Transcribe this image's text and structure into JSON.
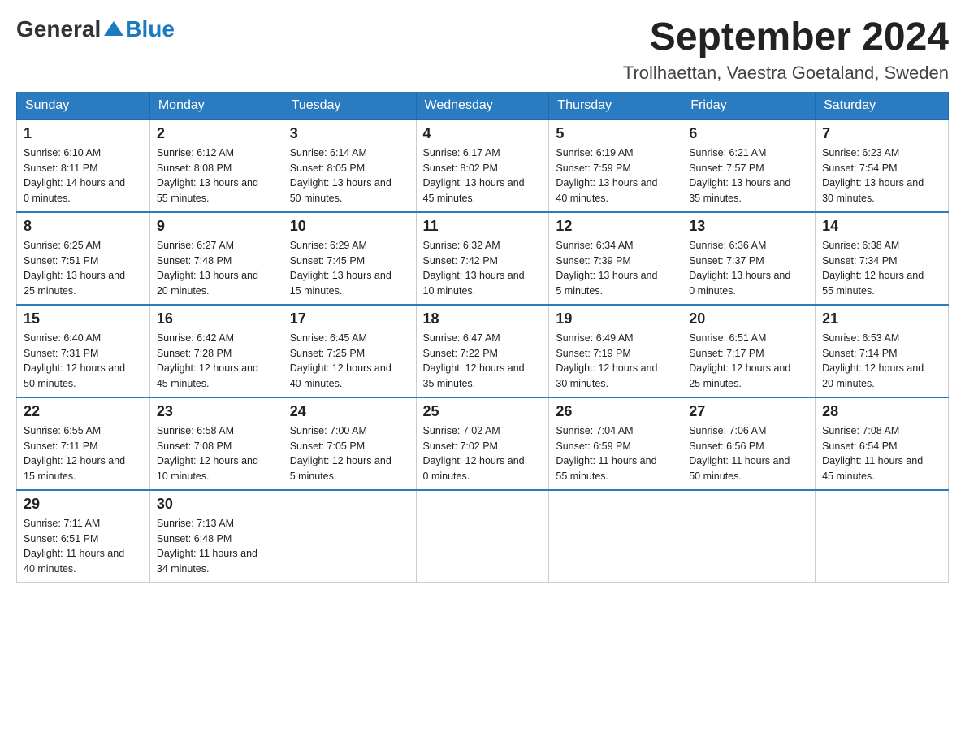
{
  "header": {
    "logo_general": "General",
    "logo_blue": "Blue",
    "month_title": "September 2024",
    "location": "Trollhaettan, Vaestra Goetaland, Sweden"
  },
  "weekdays": [
    "Sunday",
    "Monday",
    "Tuesday",
    "Wednesday",
    "Thursday",
    "Friday",
    "Saturday"
  ],
  "weeks": [
    [
      {
        "day": "1",
        "sunrise": "6:10 AM",
        "sunset": "8:11 PM",
        "daylight": "14 hours and 0 minutes."
      },
      {
        "day": "2",
        "sunrise": "6:12 AM",
        "sunset": "8:08 PM",
        "daylight": "13 hours and 55 minutes."
      },
      {
        "day": "3",
        "sunrise": "6:14 AM",
        "sunset": "8:05 PM",
        "daylight": "13 hours and 50 minutes."
      },
      {
        "day": "4",
        "sunrise": "6:17 AM",
        "sunset": "8:02 PM",
        "daylight": "13 hours and 45 minutes."
      },
      {
        "day": "5",
        "sunrise": "6:19 AM",
        "sunset": "7:59 PM",
        "daylight": "13 hours and 40 minutes."
      },
      {
        "day": "6",
        "sunrise": "6:21 AM",
        "sunset": "7:57 PM",
        "daylight": "13 hours and 35 minutes."
      },
      {
        "day": "7",
        "sunrise": "6:23 AM",
        "sunset": "7:54 PM",
        "daylight": "13 hours and 30 minutes."
      }
    ],
    [
      {
        "day": "8",
        "sunrise": "6:25 AM",
        "sunset": "7:51 PM",
        "daylight": "13 hours and 25 minutes."
      },
      {
        "day": "9",
        "sunrise": "6:27 AM",
        "sunset": "7:48 PM",
        "daylight": "13 hours and 20 minutes."
      },
      {
        "day": "10",
        "sunrise": "6:29 AM",
        "sunset": "7:45 PM",
        "daylight": "13 hours and 15 minutes."
      },
      {
        "day": "11",
        "sunrise": "6:32 AM",
        "sunset": "7:42 PM",
        "daylight": "13 hours and 10 minutes."
      },
      {
        "day": "12",
        "sunrise": "6:34 AM",
        "sunset": "7:39 PM",
        "daylight": "13 hours and 5 minutes."
      },
      {
        "day": "13",
        "sunrise": "6:36 AM",
        "sunset": "7:37 PM",
        "daylight": "13 hours and 0 minutes."
      },
      {
        "day": "14",
        "sunrise": "6:38 AM",
        "sunset": "7:34 PM",
        "daylight": "12 hours and 55 minutes."
      }
    ],
    [
      {
        "day": "15",
        "sunrise": "6:40 AM",
        "sunset": "7:31 PM",
        "daylight": "12 hours and 50 minutes."
      },
      {
        "day": "16",
        "sunrise": "6:42 AM",
        "sunset": "7:28 PM",
        "daylight": "12 hours and 45 minutes."
      },
      {
        "day": "17",
        "sunrise": "6:45 AM",
        "sunset": "7:25 PM",
        "daylight": "12 hours and 40 minutes."
      },
      {
        "day": "18",
        "sunrise": "6:47 AM",
        "sunset": "7:22 PM",
        "daylight": "12 hours and 35 minutes."
      },
      {
        "day": "19",
        "sunrise": "6:49 AM",
        "sunset": "7:19 PM",
        "daylight": "12 hours and 30 minutes."
      },
      {
        "day": "20",
        "sunrise": "6:51 AM",
        "sunset": "7:17 PM",
        "daylight": "12 hours and 25 minutes."
      },
      {
        "day": "21",
        "sunrise": "6:53 AM",
        "sunset": "7:14 PM",
        "daylight": "12 hours and 20 minutes."
      }
    ],
    [
      {
        "day": "22",
        "sunrise": "6:55 AM",
        "sunset": "7:11 PM",
        "daylight": "12 hours and 15 minutes."
      },
      {
        "day": "23",
        "sunrise": "6:58 AM",
        "sunset": "7:08 PM",
        "daylight": "12 hours and 10 minutes."
      },
      {
        "day": "24",
        "sunrise": "7:00 AM",
        "sunset": "7:05 PM",
        "daylight": "12 hours and 5 minutes."
      },
      {
        "day": "25",
        "sunrise": "7:02 AM",
        "sunset": "7:02 PM",
        "daylight": "12 hours and 0 minutes."
      },
      {
        "day": "26",
        "sunrise": "7:04 AM",
        "sunset": "6:59 PM",
        "daylight": "11 hours and 55 minutes."
      },
      {
        "day": "27",
        "sunrise": "7:06 AM",
        "sunset": "6:56 PM",
        "daylight": "11 hours and 50 minutes."
      },
      {
        "day": "28",
        "sunrise": "7:08 AM",
        "sunset": "6:54 PM",
        "daylight": "11 hours and 45 minutes."
      }
    ],
    [
      {
        "day": "29",
        "sunrise": "7:11 AM",
        "sunset": "6:51 PM",
        "daylight": "11 hours and 40 minutes."
      },
      {
        "day": "30",
        "sunrise": "7:13 AM",
        "sunset": "6:48 PM",
        "daylight": "11 hours and 34 minutes."
      },
      null,
      null,
      null,
      null,
      null
    ]
  ],
  "labels": {
    "sunrise": "Sunrise:",
    "sunset": "Sunset:",
    "daylight": "Daylight:"
  }
}
